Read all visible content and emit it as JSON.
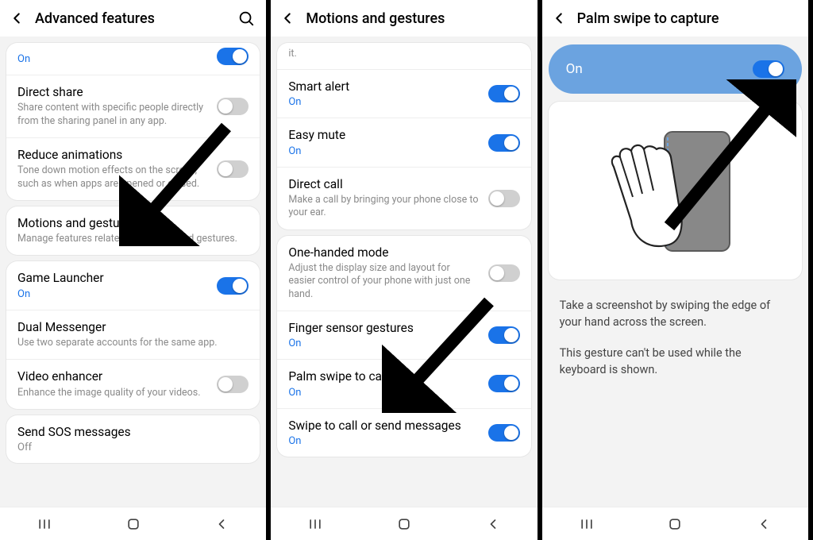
{
  "panel1": {
    "title": "Advanced features",
    "partial_status": "On",
    "items": [
      {
        "title": "Direct share",
        "sub": "Share content with specific people directly from the sharing panel in any app.",
        "toggle": "off"
      },
      {
        "title": "Reduce animations",
        "sub": "Tone down motion effects on the screen, such as when apps are opened or closed.",
        "toggle": "off"
      },
      {
        "title": "Motions and gestures",
        "sub": "Manage features related to motions and gestures."
      },
      {
        "title": "Game Launcher",
        "status": "On",
        "toggle": "on"
      },
      {
        "title": "Dual Messenger",
        "sub": "Use two separate accounts for the same app."
      },
      {
        "title": "Video enhancer",
        "sub": "Enhance the image quality of your videos.",
        "toggle": "off"
      },
      {
        "title": "Send SOS messages",
        "status": "Off"
      }
    ]
  },
  "panel2": {
    "title": "Motions and gestures",
    "partial_text": "it.",
    "items": [
      {
        "title": "Smart alert",
        "status": "On",
        "toggle": "on"
      },
      {
        "title": "Easy mute",
        "status": "On",
        "toggle": "on"
      },
      {
        "title": "Direct call",
        "sub": "Make a call by bringing your phone close to your ear.",
        "toggle": "off"
      },
      {
        "title": "One-handed mode",
        "sub": "Adjust the display size and layout for easier control of your phone with just one hand.",
        "toggle": "off"
      },
      {
        "title": "Finger sensor gestures",
        "status": "On",
        "toggle": "on"
      },
      {
        "title": "Palm swipe to capture",
        "status": "On",
        "toggle": "on"
      },
      {
        "title": "Swipe to call or send messages",
        "status": "On",
        "toggle": "on"
      }
    ]
  },
  "panel3": {
    "title": "Palm swipe to capture",
    "on_label": "On",
    "desc1": "Take a screenshot by swiping the edge of your hand across the screen.",
    "desc2": "This gesture can't be used while the keyboard is shown."
  }
}
